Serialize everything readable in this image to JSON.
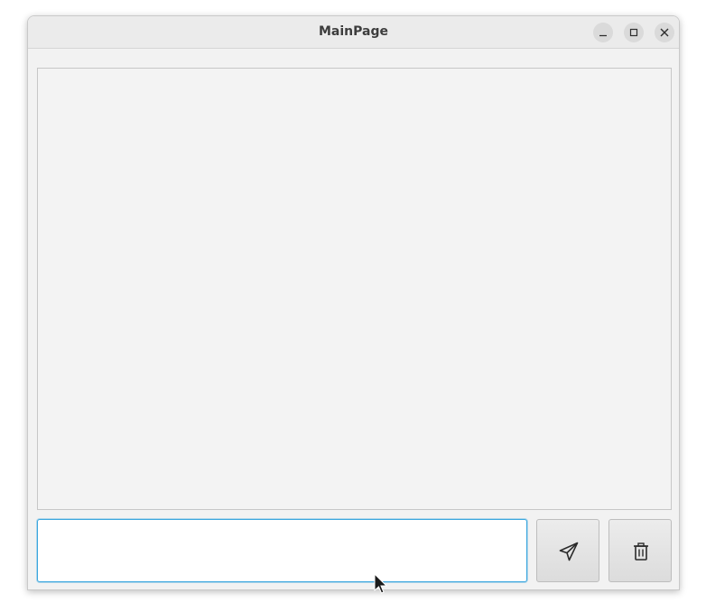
{
  "window": {
    "title": "MainPage",
    "controls": {
      "minimize_icon": "minimize-icon",
      "maximize_icon": "maximize-icon",
      "close_icon": "close-icon"
    }
  },
  "chat": {
    "messages": []
  },
  "composer": {
    "input_value": "",
    "send_icon": "paper-plane-icon",
    "clear_icon": "trash-icon"
  },
  "colors": {
    "focus_border": "#3aa6de",
    "titlebar": "#ebebeb",
    "content_bg": "#f2f2f2"
  }
}
